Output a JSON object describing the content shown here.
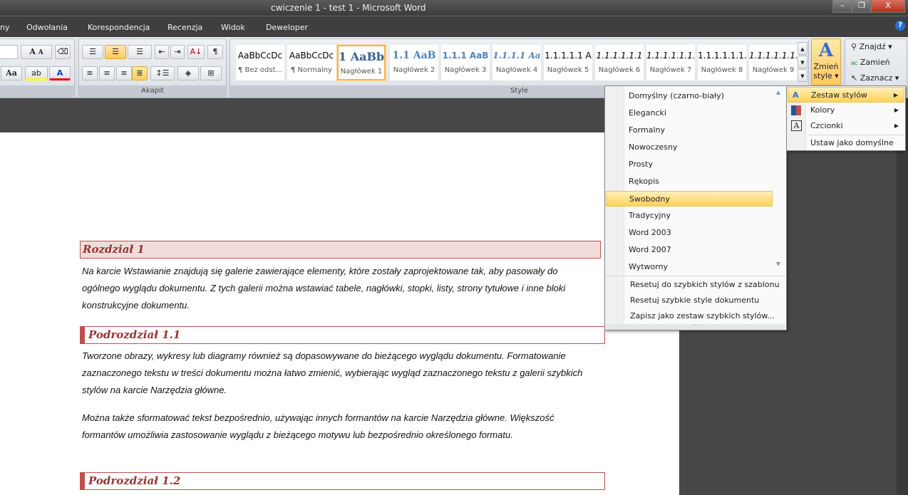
{
  "window": {
    "title": "cwiczenie 1 - test 1 - Microsoft Word",
    "minimize": "–",
    "restore": "❐",
    "close": "X"
  },
  "tabs": [
    "ny",
    "Odwołania",
    "Korespondencja",
    "Recenzja",
    "Widok",
    "Deweloper"
  ],
  "help_icon": "?",
  "ribbon": {
    "font_group": {
      "grow": "A",
      "shrink": "A",
      "case": "Aa",
      "highlight": "ab",
      "font_color": "A"
    },
    "paragraph_group": {
      "label": "Akapit",
      "sort": "A↓",
      "pilcrow": "¶"
    },
    "styles_group": {
      "label": "Style",
      "styles": [
        {
          "preview": "AaBbCcDc",
          "name": "¶ Bez odst..."
        },
        {
          "preview": "AaBbCcDc",
          "name": "¶ Normalny"
        },
        {
          "preview": "1 AaBb",
          "name": "Nagłówek 1"
        },
        {
          "preview": "1.1 AaB",
          "name": "Nagłówek 2"
        },
        {
          "preview": "1.1.1 AaB",
          "name": "Nagłówek 3"
        },
        {
          "preview": "1.1.1.1 Aa",
          "name": "Nagłówek 4"
        },
        {
          "preview": "1.1.1.1.1 A",
          "name": "Nagłówek 5"
        },
        {
          "preview": "1.1.1.1.1.1",
          "name": "Nagłówek 6"
        },
        {
          "preview": "1.1.1.1.1.1.",
          "name": "Nagłówek 7"
        },
        {
          "preview": "1.1.1.1.1.1.",
          "name": "Nagłówek 8"
        },
        {
          "preview": "1.1.1.1.1.1.",
          "name": "Nagłówek 9"
        }
      ]
    },
    "change_styles": {
      "line1": "Zmień",
      "line2": "style ▾"
    },
    "editing": {
      "find": "Znajdź ▾",
      "replace": "Zamień",
      "select": "Zaznacz ▾"
    }
  },
  "document": {
    "h1": "Rozdział 1",
    "p1": "Na karcie Wstawianie znajdują się galerie zawierające elementy, które zostały zaprojektowane tak, aby pasowały do ogólnego wyglądu dokumentu.  Z tych galerii można wstawiać tabele, nagłówki, stopki, listy, strony tytułowe i inne bloki konstrukcyjne dokumentu.",
    "h2a": "Podrozdział 1.1",
    "p2": "Tworzone obrazy, wykresy lub diagramy również są dopasowywane do bieżącego wyglądu dokumentu. Formatowanie zaznaczonego tekstu w treści dokumentu można łatwo zmienić, wybierając wygląd zaznaczonego tekstu z galerii szybkich stylów na karcie Narzędzia główne.",
    "p3": "Można także sformatować tekst bezpośrednio, używając innych formantów na karcie Narzędzia główne. Większość formantów umożliwia zastosowanie wyglądu z bieżącego motywu lub bezpośrednio określonego formatu.",
    "h2b": "Podrozdział 1.2"
  },
  "style_set_menu": {
    "items": [
      "Domyślny (czarno-biały)",
      "Elegancki",
      "Formalny",
      "Nowoczesny",
      "Prosty",
      "Rękopis",
      "Swobodny",
      "Tradycyjny",
      "Word 2003",
      "Word 2007",
      "Wytworny"
    ],
    "highlighted": "Swobodny",
    "actions": [
      "Resetuj do szybkich stylów z szablonu",
      "Resetuj szybkie style dokumentu",
      "Zapisz jako zestaw szybkich stylów..."
    ]
  },
  "change_styles_menu": {
    "items": [
      "Zestaw stylów",
      "Kolory",
      "Czcionki",
      "Ustaw jako domyślne"
    ],
    "highlighted": "Zestaw stylów"
  },
  "colors": {
    "heading": "#943634",
    "heading_border": "#c0504d",
    "heading_fill": "#f2dbdb",
    "highlight": "#ffd25c"
  }
}
